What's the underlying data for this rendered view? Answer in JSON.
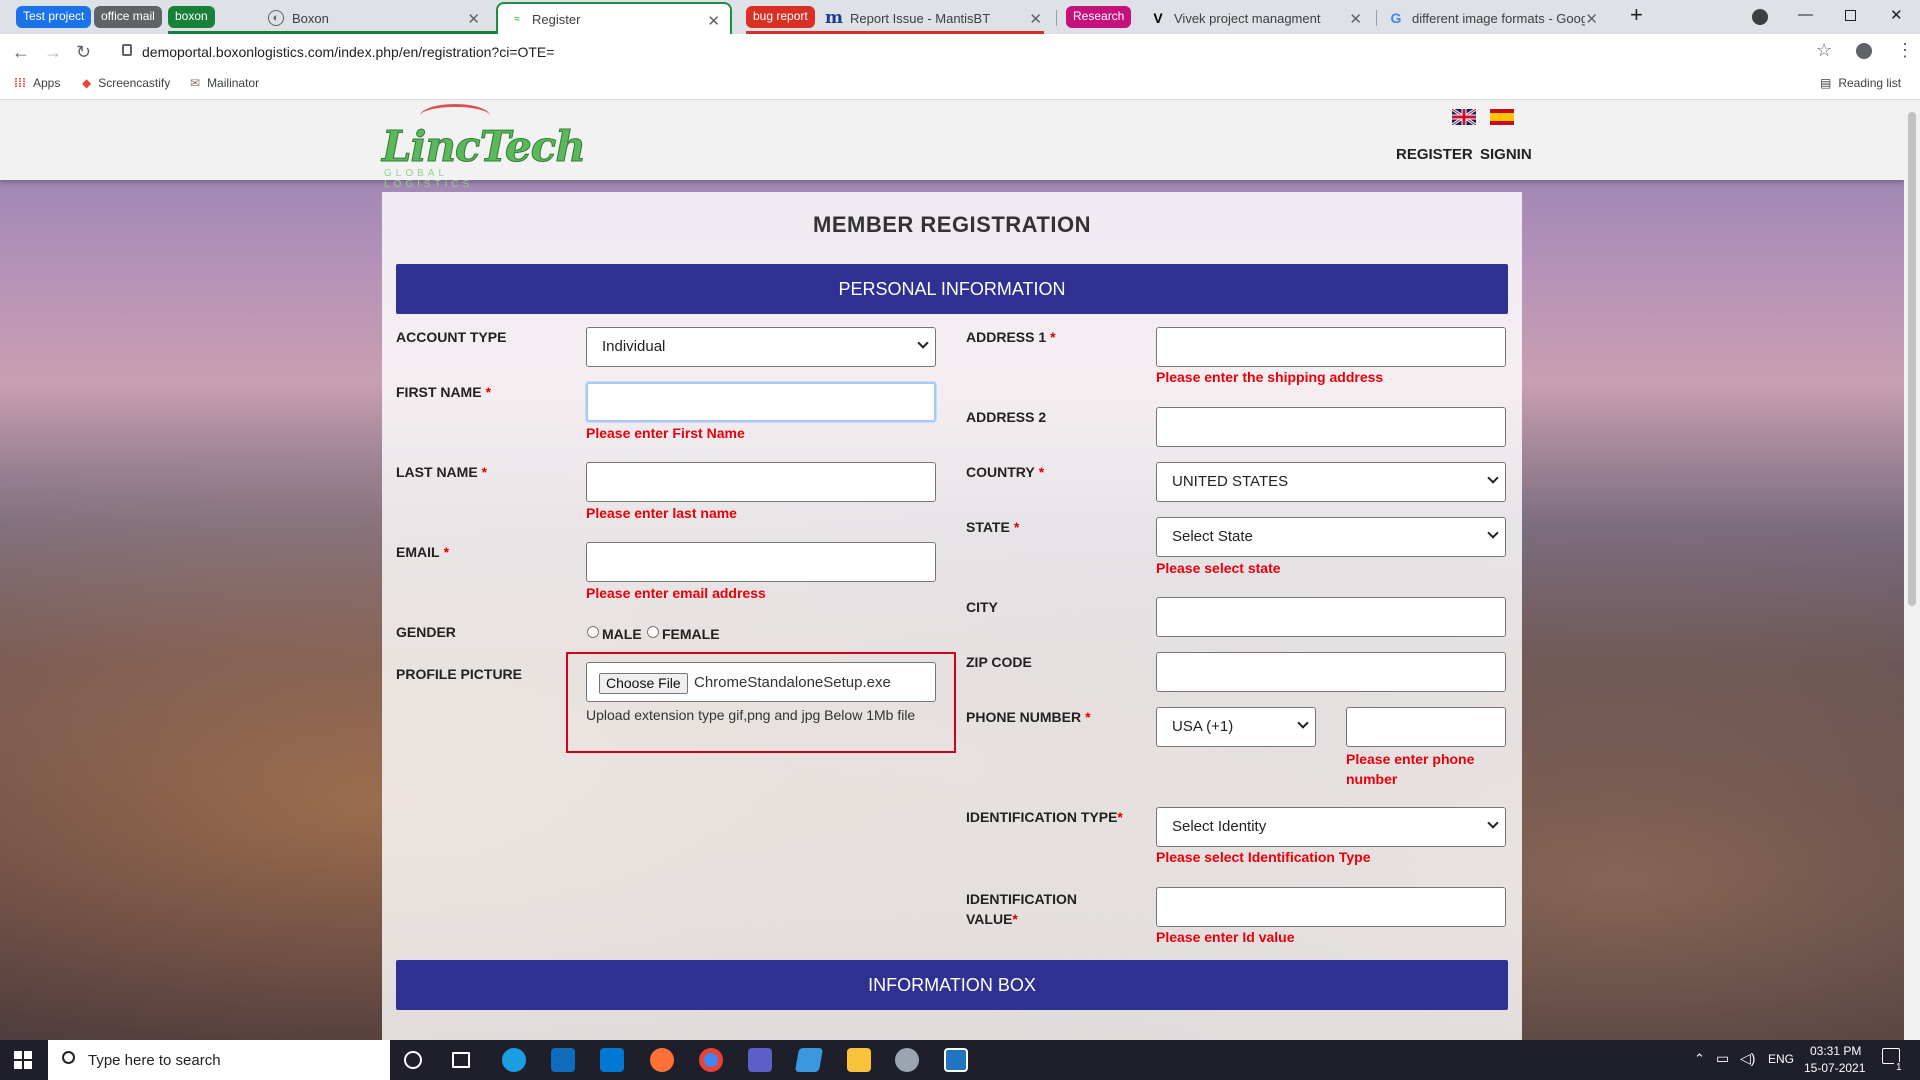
{
  "browser": {
    "tabs": [
      {
        "type": "group",
        "label": "Test project",
        "color": "#1a73e8"
      },
      {
        "type": "group",
        "label": "office mail",
        "color": "#5f6368"
      },
      {
        "type": "group",
        "label": "boxon",
        "color": "#188038"
      },
      {
        "type": "tab",
        "label": "Boxon"
      },
      {
        "type": "tab",
        "label": "Register",
        "active": true
      },
      {
        "type": "group",
        "label": "bug report",
        "color": "#d93025"
      },
      {
        "type": "tab",
        "label": "Report Issue - MantisBT"
      },
      {
        "type": "group",
        "label": "Research",
        "color": "#c5117b"
      },
      {
        "type": "tab",
        "label": "Vivek project managment"
      },
      {
        "type": "tab",
        "label": "different image formats - Google"
      }
    ],
    "url": "demoportal.boxonlogistics.com/index.php/en/registration?ci=OTE=",
    "bookmarks": [
      "Apps",
      "Screencastify",
      "Mailinator"
    ],
    "reading_list": "Reading list"
  },
  "site": {
    "logo_text": "LincTech",
    "logo_sub": "GLOBAL LOGISTICS",
    "nav": {
      "register": "REGISTER",
      "signin": "SIGNIN"
    }
  },
  "form": {
    "title": "MEMBER REGISTRATION",
    "personal_section": "PERSONAL INFORMATION",
    "info_section": "INFORMATION BOX",
    "account_type": {
      "label": "ACCOUNT TYPE",
      "value": "Individual"
    },
    "first_name": {
      "label": "FIRST NAME",
      "error": "Please enter First Name"
    },
    "last_name": {
      "label": "LAST NAME",
      "error": "Please enter last name"
    },
    "email": {
      "label": "EMAIL",
      "error": "Please enter email address"
    },
    "gender": {
      "label": "GENDER",
      "male": "MALE",
      "female": "FEMALE"
    },
    "profile_picture": {
      "label": "PROFILE PICTURE",
      "button": "Choose File",
      "file_name": "ChromeStandaloneSetup.exe",
      "hint": "Upload extension type gif,png and jpg Below 1Mb file"
    },
    "address1": {
      "label": "ADDRESS 1",
      "error": "Please enter the shipping address"
    },
    "address2": {
      "label": "ADDRESS 2"
    },
    "country": {
      "label": "COUNTRY",
      "value": "UNITED STATES"
    },
    "state": {
      "label": "STATE",
      "value": "Select State",
      "error": "Please select state"
    },
    "city": {
      "label": "CITY"
    },
    "zip": {
      "label": "ZIP CODE"
    },
    "phone": {
      "label": "PHONE NUMBER",
      "code": "USA (+1)",
      "error": "Please enter phone number"
    },
    "id_type": {
      "label": "IDENTIFICATION TYPE",
      "value": "Select Identity",
      "error": "Please select Identification Type"
    },
    "id_value": {
      "label": "IDENTIFICATION VALUE",
      "error": "Please enter Id value"
    },
    "required_mark": "*"
  },
  "taskbar": {
    "search_placeholder": "Type here to search",
    "lang": "ENG",
    "time": "03:31 PM",
    "date": "15-07-2021",
    "notifications": "1"
  }
}
